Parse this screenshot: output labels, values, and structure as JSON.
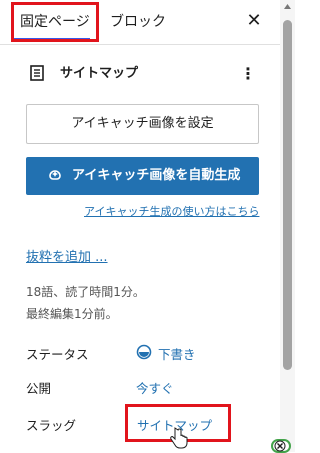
{
  "tabs": {
    "page_label": "固定ページ",
    "block_label": "ブロック"
  },
  "document": {
    "title": "サイトマップ"
  },
  "buttons": {
    "set_featured_image": "アイキャッチ画像を設定",
    "auto_generate_featured_image": "アイキャッチ画像を自動生成"
  },
  "links": {
    "featured_help": "アイキャッチ生成の使い方はこちら",
    "add_excerpt": "抜粋を追加 ..."
  },
  "meta": {
    "word_count": "18語、読了時間1分。",
    "last_edited": "最終編集1分前。"
  },
  "rows": {
    "status": {
      "label": "ステータス",
      "value": "下書き"
    },
    "publish": {
      "label": "公開",
      "value": "今すぐ"
    },
    "slug": {
      "label": "スラッグ",
      "value": "サイトマップ"
    }
  },
  "colors": {
    "accent": "#2271b1",
    "tab_indicator": "#3858e9",
    "highlight_box": "#e1141c"
  },
  "icons": {
    "close": "close-icon",
    "document": "document-icon",
    "more": "more-vertical-icon",
    "ai_generate": "ai-generate-icon",
    "status": "draft-status-icon"
  }
}
